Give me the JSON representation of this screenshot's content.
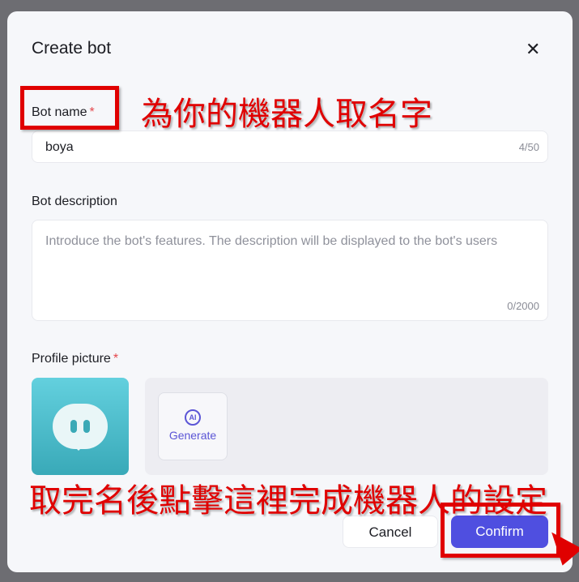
{
  "dialog": {
    "title": "Create bot",
    "close_icon": "close-icon"
  },
  "bot_name": {
    "label": "Bot name",
    "required": "*",
    "value": "boya",
    "counter": "4/50"
  },
  "bot_description": {
    "label": "Bot description",
    "placeholder": "Introduce the bot's features. The description will be displayed to the bot's users",
    "counter": "0/2000"
  },
  "profile_picture": {
    "label": "Profile picture",
    "required": "*",
    "generate_label": "Generate",
    "ai_badge": "AI"
  },
  "buttons": {
    "cancel": "Cancel",
    "confirm": "Confirm",
    "confirm_color": "#4f4fe0"
  },
  "annotations": {
    "name_hint": "為你的機器人取名字",
    "confirm_hint": "取完名後點擊這裡完成機器人的設定",
    "color": "#e00000"
  }
}
